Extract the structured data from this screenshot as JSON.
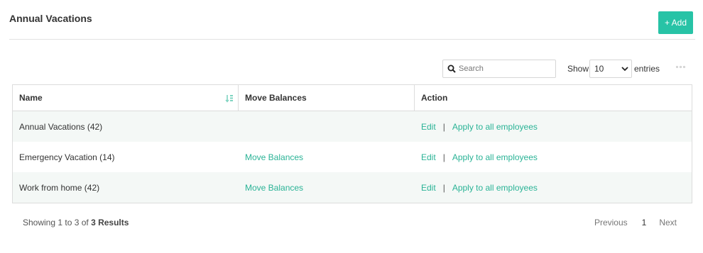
{
  "header": {
    "title": "Annual Vacations",
    "add_label": "+ Add"
  },
  "toolbar": {
    "search_placeholder": "Search",
    "show_label": "Show",
    "entries_value": "10",
    "entries_label": "entries"
  },
  "table": {
    "columns": [
      "Name",
      "Move Balances",
      "Action"
    ],
    "rows": [
      {
        "name": "Annual Vacations (42)",
        "move": "",
        "edit": "Edit",
        "apply": "Apply to all employees"
      },
      {
        "name": "Emergency Vacation (14)",
        "move": "Move Balances",
        "edit": "Edit",
        "apply": "Apply to all employees"
      },
      {
        "name": "Work from home (42)",
        "move": "Move Balances",
        "edit": "Edit",
        "apply": "Apply to all employees"
      }
    ],
    "separator": "|"
  },
  "footer": {
    "showing_prefix": "Showing 1 to 3 of ",
    "showing_count": "3 Results"
  },
  "pagination": {
    "previous": "Previous",
    "current": "1",
    "next": "Next"
  },
  "colors": {
    "accent": "#27c3a6",
    "link": "#2ab396",
    "row_alt": "#f4f8f6"
  },
  "icons": {
    "search": "search-icon",
    "sort": "sort-icon",
    "chevron": "chevron-down-icon",
    "more": "more-icon"
  }
}
